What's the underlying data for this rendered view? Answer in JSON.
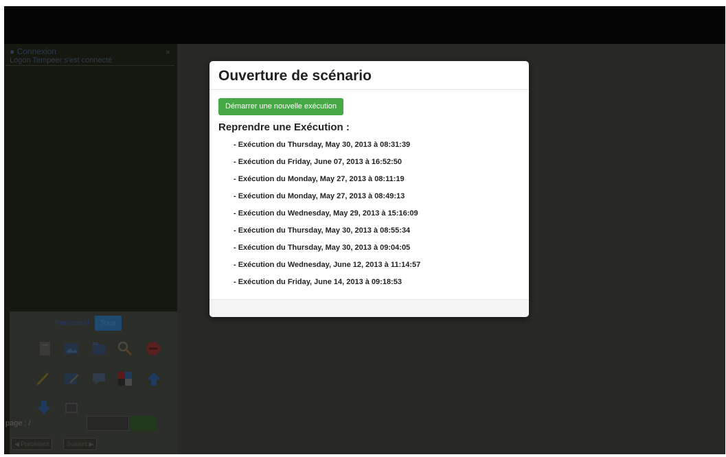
{
  "sidebar": {
    "panel_title": "Connexion",
    "panel_status": "Logon Tempeer s'est connecté",
    "close_glyph": "×",
    "tabs": [
      "Personnel",
      "Tous"
    ],
    "tool_icons": [
      "document-icon",
      "image-icon",
      "folder-icon",
      "search-icon",
      "stop-icon",
      "pencil-icon",
      "edit-image-icon",
      "comment-icon",
      "color-palette-icon",
      "arrow-up-icon",
      "arrow-down-icon",
      "gallery-icon"
    ],
    "page_label": "page : /",
    "prev_label": "◀ Précédent",
    "next_label": "Suivant ▶"
  },
  "modal": {
    "title": "Ouverture de scénario",
    "start_button": "Démarrer une nouvelle exécution",
    "resume_heading": "Reprendre une Exécution :",
    "executions": [
      "- Exécution du Thursday, May 30, 2013 à 08:31:39",
      "- Exécution du Friday, June 07, 2013 à 16:52:50",
      "- Exécution du Monday, May 27, 2013 à 08:11:19",
      "- Exécution du Monday, May 27, 2013 à 08:49:13",
      "- Exécution du Wednesday, May 29, 2013 à 15:16:09",
      "- Exécution du Thursday, May 30, 2013 à 08:55:34",
      "- Exécution du Thursday, May 30, 2013 à 09:04:05",
      "- Exécution du Wednesday, June 12, 2013 à 11:14:57",
      "- Exécution du Friday, June 14, 2013 à 09:18:53"
    ]
  },
  "colors": {
    "accent_green": "#46a945",
    "overlay": "#292a27",
    "modal_bg": "#ffffff"
  }
}
